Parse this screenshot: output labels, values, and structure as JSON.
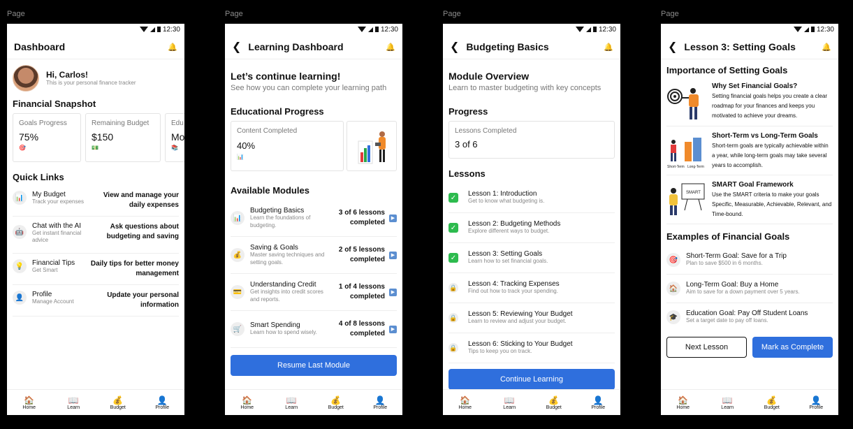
{
  "page_label": "Page",
  "status": {
    "time": "12:30"
  },
  "nav": [
    {
      "label": "Home",
      "icon": "🏠"
    },
    {
      "label": "Learn",
      "icon": "📖"
    },
    {
      "label": "Budget",
      "icon": "💰"
    },
    {
      "label": "Profile",
      "icon": "👤"
    }
  ],
  "screen1": {
    "title": "Dashboard",
    "greeting": "Hi, Carlos!",
    "greeting_sub": "This is your personal finance tracker",
    "snapshot_title": "Financial Snapshot",
    "cards": [
      {
        "label": "Goals Progress",
        "value": "75%",
        "icon": "🎯"
      },
      {
        "label": "Remaining Budget",
        "value": "$150",
        "icon": "💵"
      },
      {
        "label": "Edu",
        "value": "Mo",
        "icon": "📚"
      }
    ],
    "quick_title": "Quick Links",
    "links": [
      {
        "title": "My Budget",
        "sub": "Track your expenses",
        "desc": "View and manage your daily expenses",
        "icon": "📊"
      },
      {
        "title": "Chat with the AI",
        "sub": "Get instant financial advice",
        "desc": "Ask questions about budgeting and saving",
        "icon": "🤖"
      },
      {
        "title": "Financial Tips",
        "sub": "Get Smart",
        "desc": "Daily tips for better money management",
        "icon": "💡"
      },
      {
        "title": "Profile",
        "sub": "Manage Account",
        "desc": "Update your personal information",
        "icon": "👤"
      }
    ]
  },
  "screen2": {
    "title": "Learning Dashboard",
    "heading": "Let’s continue learning!",
    "heading_sub": "See how you can complete your learning path",
    "progress_title": "Educational Progress",
    "progress_label": "Content Completed",
    "progress_value": "40%",
    "modules_title": "Available Modules",
    "modules": [
      {
        "title": "Budgeting Basics",
        "sub": "Learn the foundations of budgeting.",
        "status": "3 of 6 lessons completed",
        "icon": "📊"
      },
      {
        "title": "Saving & Goals",
        "sub": "Master saving techniques and setting goals.",
        "status": "2 of 5 lessons completed",
        "icon": "💰"
      },
      {
        "title": "Understanding Credit",
        "sub": "Get insights into credit scores and reports.",
        "status": "1 of 4 lessons completed",
        "icon": "💳"
      },
      {
        "title": "Smart Spending",
        "sub": "Learn how to spend wisely.",
        "status": "4 of 8 lessons completed",
        "icon": "🛒"
      }
    ],
    "button": "Resume Last Module"
  },
  "screen3": {
    "title": "Budgeting Basics",
    "heading": "Module Overview",
    "heading_sub": "Learn to master budgeting with key concepts",
    "progress_title": "Progress",
    "progress_label": "Lessons Completed",
    "progress_value": "3 of 6",
    "lessons_title": "Lessons",
    "lessons": [
      {
        "title": "Lesson 1: Introduction",
        "sub": "Get to know what budgeting is.",
        "done": true
      },
      {
        "title": "Lesson 2: Budgeting Methods",
        "sub": "Explore different ways to budget.",
        "done": true
      },
      {
        "title": "Lesson 3: Setting Goals",
        "sub": "Learn how to set financial goals.",
        "done": true
      },
      {
        "title": "Lesson 4: Tracking Expenses",
        "sub": "Find out how to track your spending.",
        "done": false
      },
      {
        "title": "Lesson 5: Reviewing Your Budget",
        "sub": "Learn to review and adjust your budget.",
        "done": false
      },
      {
        "title": "Lesson 6: Sticking to Your Budget",
        "sub": "Tips to keep you on track.",
        "done": false
      }
    ],
    "button": "Continue Learning"
  },
  "screen4": {
    "title": "Lesson 3: Setting Goals",
    "importance_title": "Importance of Setting Goals",
    "topics": [
      {
        "title": "Why Set Financial Goals?",
        "body": "Setting financial goals helps you create a clear roadmap for your finances and keeps you motivated to achieve your dreams."
      },
      {
        "title": "Short-Term vs Long-Term Goals",
        "body": "Short-term goals are typically achievable within a year, while long-term goals may take several years to accomplish.",
        "caption_a": "Short-Term",
        "caption_b": "Long-Term"
      },
      {
        "title": "SMART Goal Framework",
        "body": "Use the SMART criteria to make your goals Specific, Measurable, Achievable, Relevant, and Time-bound.",
        "board_text": "SMART"
      }
    ],
    "examples_title": "Examples of Financial Goals",
    "examples": [
      {
        "title": "Short-Term Goal: Save for a Trip",
        "sub": "Plan to save $500 in 6 months.",
        "icon": "🎯"
      },
      {
        "title": "Long-Term Goal: Buy a Home",
        "sub": "Aim to save for a down payment over 5 years.",
        "icon": "🏠"
      },
      {
        "title": "Education Goal: Pay Off Student Loans",
        "sub": "Set a target date to pay off loans.",
        "icon": "🎓"
      }
    ],
    "next_button": "Next Lesson",
    "complete_button": "Mark as Complete"
  }
}
